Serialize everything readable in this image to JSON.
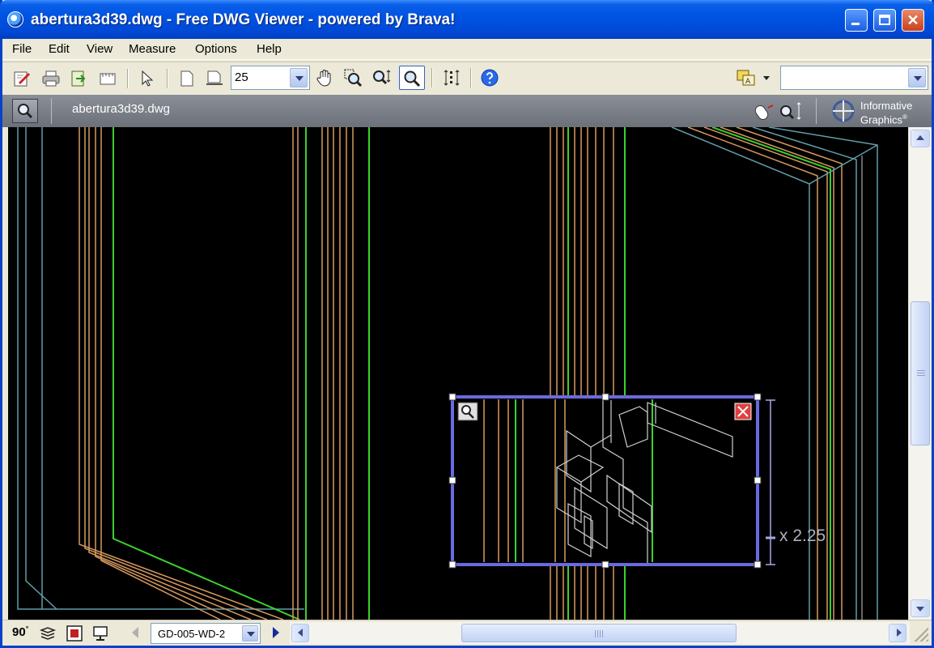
{
  "window": {
    "title": "abertura3d39.dwg - Free DWG Viewer - powered by Brava!",
    "minimize_glyph": "",
    "close_glyph": "✕"
  },
  "menu": [
    "File",
    "Edit",
    "View",
    "Measure",
    "Options",
    "Help"
  ],
  "toolbar": {
    "zoom_value": "25",
    "search_value": "",
    "icons": [
      "markup-icon",
      "print-icon",
      "export-icon",
      "layout-icon",
      "select-pointer-icon",
      "page-icon",
      "page-setup-icon",
      "pan-hand-icon",
      "zoom-window-icon",
      "zoom-in-out-icon",
      "magnifier-icon",
      "fit-vertical-icon",
      "help-icon",
      "language-icon"
    ]
  },
  "document": {
    "file_name": "abertura3d39.dwg",
    "brand_line1": "Informative",
    "brand_line2": "Graphics",
    "brand_mark": "®"
  },
  "magnifier": {
    "zoom_label": "x 2.25"
  },
  "statusbar": {
    "rotation": "90",
    "rotation_mark": "°",
    "page_name": "GD-005-WD-2"
  },
  "colors": {
    "title_bar": "#0054e3",
    "canvas_background": "#000000",
    "line_orange": "#d89a5e",
    "line_green": "#3cd02c",
    "line_cyan": "#5f9ea8",
    "line_gray": "#c8c8c8",
    "magnifier_frame": "#6a6ae0"
  }
}
